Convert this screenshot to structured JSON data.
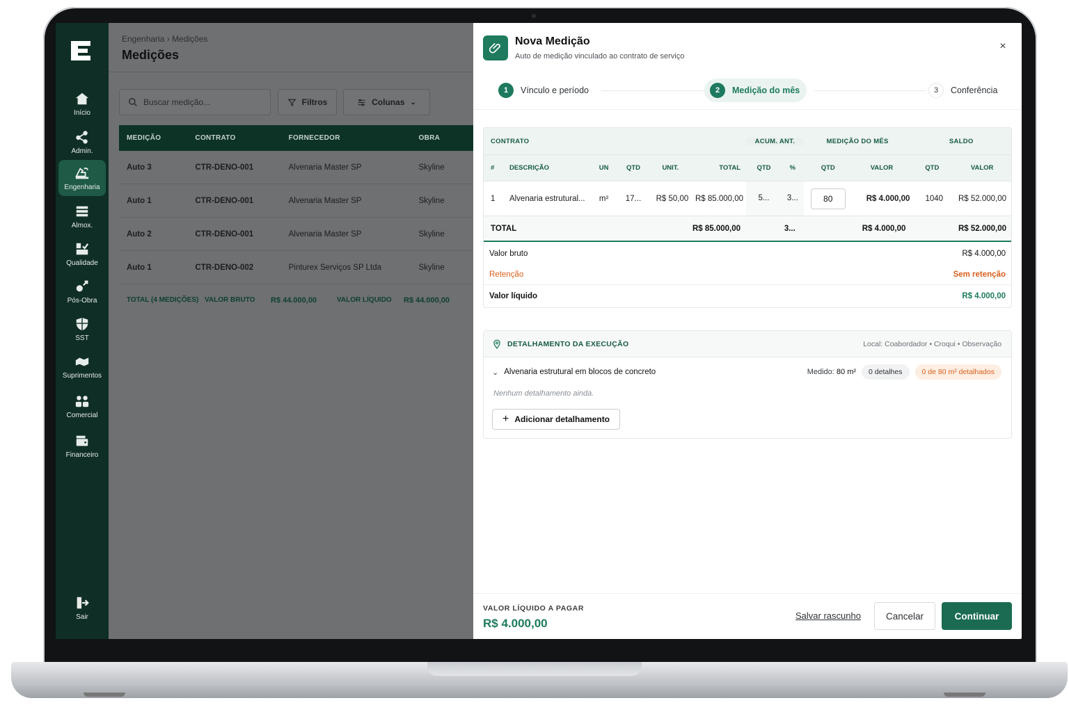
{
  "sidebar": {
    "items": [
      {
        "label": "Início",
        "icon": "home-icon"
      },
      {
        "label": "Admin.",
        "icon": "network-icon"
      },
      {
        "label": "Engenharia",
        "icon": "engineering-icon",
        "active": true
      },
      {
        "label": "Almox.",
        "icon": "warehouse-icon"
      },
      {
        "label": "Qualidade",
        "icon": "quality-icon"
      },
      {
        "label": "Pós-Obra",
        "icon": "post-work-icon"
      },
      {
        "label": "SST",
        "icon": "shield-icon"
      },
      {
        "label": "Suprimentos",
        "icon": "supplies-icon"
      },
      {
        "label": "Comercial",
        "icon": "people-icon"
      },
      {
        "label": "Financeiro",
        "icon": "wallet-icon"
      }
    ],
    "logout": {
      "label": "Sair",
      "icon": "logout-icon"
    }
  },
  "main": {
    "breadcrumb": "Engenharia › Medições",
    "title": "Medições",
    "search_placeholder": "Buscar medição...",
    "filters_label": "Filtros",
    "columns_label": "Colunas",
    "table": {
      "headers": [
        "MEDIÇÃO",
        "CONTRATO",
        "FORNECEDOR",
        "OBRA"
      ],
      "rows": [
        [
          "Auto 3",
          "CTR-DENO-001",
          "Alvenaria Master SP",
          "Skyline"
        ],
        [
          "Auto 1",
          "CTR-DENO-001",
          "Alvenaria Master SP",
          "Skyline"
        ],
        [
          "Auto 2",
          "CTR-DENO-001",
          "Alvenaria Master SP",
          "Skyline"
        ],
        [
          "Auto 1",
          "CTR-DENO-002",
          "Pinturex Serviços SP Ltda",
          "Skyline"
        ]
      ],
      "footer": {
        "total_label": "TOTAL (4 MEDIÇÕES)",
        "gross_label": "VALOR BRUTO",
        "gross_value": "R$ 44.000,00",
        "net_label": "VALOR LÍQUIDO",
        "net_value": "R$ 44.000,00"
      }
    }
  },
  "panel": {
    "title": "Nova Medição",
    "subtitle": "Auto de medição vinculado ao contrato de serviço",
    "close_glyph": "×",
    "steps": [
      {
        "num": "1",
        "label": "Vínculo e período",
        "state": "done"
      },
      {
        "num": "2",
        "label": "Medição do mês",
        "state": "active"
      },
      {
        "num": "3",
        "label": "Conferência",
        "state": "pending"
      }
    ],
    "measurement": {
      "groups": {
        "contract": "CONTRATO",
        "accum": "ACUM. ANT.",
        "month": "MEDIÇÃO DO MÊS",
        "balance": "SALDO"
      },
      "columns": [
        "#",
        "DESCRIÇÃO",
        "UN",
        "QTD",
        "UNIT.",
        "TOTAL",
        "QTD",
        "%",
        "QTD",
        "VALOR",
        "QTD",
        "VALOR"
      ],
      "row": {
        "num": "1",
        "desc": "Alvenaria estrutural...",
        "un": "m²",
        "qtd": "17...",
        "unit": "R$ 50,00",
        "total": "R$ 85.000,00",
        "acc_qtd": "5...",
        "acc_pct": "3...",
        "month_qtd": "80",
        "month_val": "R$ 4.000,00",
        "bal_qtd": "1040",
        "bal_val": "R$ 52.000,00"
      },
      "totals": {
        "label": "TOTAL",
        "total": "R$ 85.000,00",
        "acc_pct": "3...",
        "month_val": "R$ 4.000,00",
        "bal_val": "R$ 52.000,00"
      },
      "summary": {
        "gross_label": "Valor bruto",
        "gross_value": "R$ 4.000,00",
        "retention_label": "Retenção",
        "retention_value": "Sem retenção",
        "net_label": "Valor líquido",
        "net_value": "R$ 4.000,00"
      }
    },
    "detail": {
      "title": "DETALHAMENTO DA EXECUÇÃO",
      "meta": "Local: Coabordador • Croqui • Observação",
      "item": "Alvenaria estrutural em blocos de concreto",
      "measured_label": "Medido:",
      "measured_value": "80 m²",
      "details_badge": "0 detalhes",
      "progress_badge": "0 de 80 m² detalhados",
      "empty_text": "Nenhum detalhamento ainda.",
      "add_button": "Adicionar detalhamento"
    },
    "footer": {
      "label": "VALOR LÍQUIDO A PAGAR",
      "value": "R$ 4.000,00",
      "save_draft": "Salvar rascunho",
      "cancel": "Cancelar",
      "continue": "Continuar"
    }
  },
  "colors": {
    "brand_dark": "#0f2e25",
    "accent": "#1e7a5e",
    "retention": "#d9601c"
  }
}
